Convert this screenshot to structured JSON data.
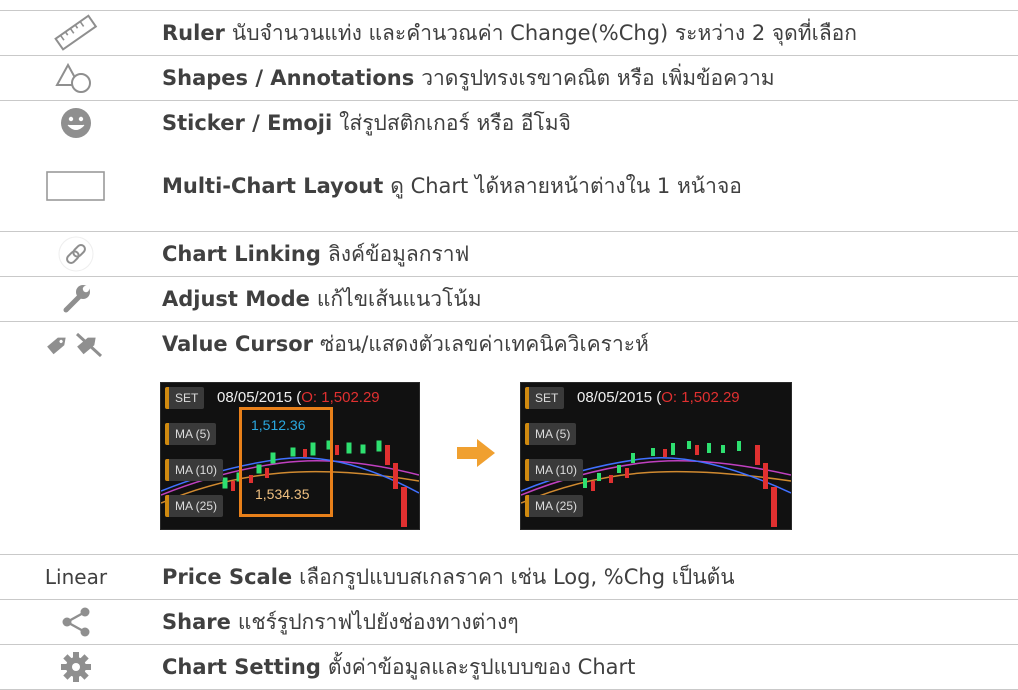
{
  "rows": [
    {
      "icon": "ruler-icon",
      "title": "Ruler",
      "text": "นับจำนวนแท่ง และคำนวณค่า Change(%Chg) ระหว่าง 2 จุดที่เลือก"
    },
    {
      "icon": "shapes-icon",
      "title": "Shapes / Annotations",
      "text": "วาดรูปทรงเรขาคณิต หรือ เพิ่มข้อความ"
    },
    {
      "icon": "smiley-icon",
      "title": "Sticker / Emoji",
      "text": "ใส่รูปสติกเกอร์ หรือ อีโมจิ"
    },
    {
      "icon": "layout-icon",
      "title": "Multi-Chart Layout",
      "text": "ดู Chart ได้หลายหน้าต่างใน 1 หน้าจอ"
    },
    {
      "icon": "link-icon",
      "title": "Chart Linking",
      "text": "ลิงค์ข้อมูลกราฟ"
    },
    {
      "icon": "wrench-icon",
      "title": "Adjust Mode",
      "text": "แก้ไขเส้นแนวโน้ม"
    },
    {
      "icon": "tag-icon",
      "title": "Value Cursor",
      "text": "ซ่อน/แสดงตัวเลขค่าเทคนิควิเคราะห์"
    },
    {
      "icon_text": "Linear",
      "title": "Price Scale",
      "text": "เลือกรูปแบบสเกลราคา เช่น Log, %Chg เป็นต้น"
    },
    {
      "icon": "share-icon",
      "title": "Share",
      "text": "แชร์รูปกราฟไปยังช่องทางต่างๆ"
    },
    {
      "icon": "gear-icon",
      "title": "Chart Setting",
      "text": "ตั้งค่าข้อมูลและรูปแบบของ Chart"
    }
  ],
  "preview": {
    "symbol": "SET",
    "date_text": "08/05/2015 (",
    "open_text": "O: 1,502.29",
    "indicators": [
      "MA (5)",
      "MA (10)",
      "MA (25)"
    ],
    "cursor_values": [
      "1,512.36",
      "1,534.35"
    ]
  },
  "colors": {
    "accent": "#e8801a",
    "text": "#404040",
    "icon_gray": "#8f8f8f"
  }
}
